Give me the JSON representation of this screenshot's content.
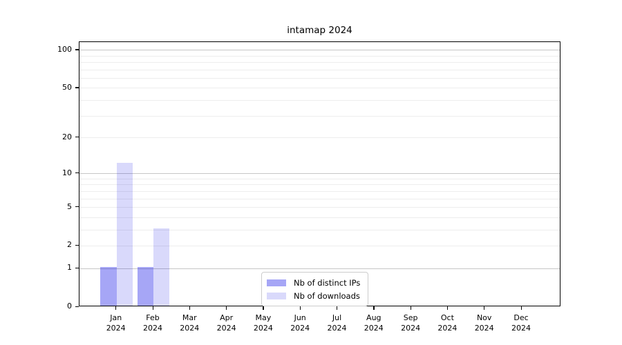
{
  "title": "intamap 2024",
  "chart_data": {
    "type": "bar",
    "title": "intamap 2024",
    "categories": [
      "Jan",
      "Feb",
      "Mar",
      "Apr",
      "May",
      "Jun",
      "Jul",
      "Aug",
      "Sep",
      "Oct",
      "Nov",
      "Dec"
    ],
    "category_year": "2024",
    "series": [
      {
        "name": "Nb of distinct IPs",
        "color": "rgba(0,0,230,0.35)",
        "values": [
          1,
          1,
          0,
          0,
          0,
          0,
          0,
          0,
          0,
          0,
          0,
          0
        ]
      },
      {
        "name": "Nb of downloads",
        "color": "rgba(0,0,230,0.15)",
        "values": [
          12,
          3,
          0,
          0,
          0,
          0,
          0,
          0,
          0,
          0,
          0,
          0
        ]
      }
    ],
    "xlabel": "",
    "ylabel": "",
    "y_axis": {
      "scale": "log1p",
      "ylim": [
        0,
        116
      ],
      "ticks": [
        0,
        1,
        2,
        5,
        10,
        20,
        50,
        100
      ],
      "minor_gridlines": [
        2,
        3,
        4,
        5,
        6,
        7,
        8,
        9,
        20,
        30,
        40,
        50,
        60,
        70,
        80,
        90
      ],
      "major_gridlines": [
        1,
        10,
        100
      ]
    },
    "grid": true,
    "legend": {
      "position": "bottom-center",
      "entries": [
        "Nb of distinct IPs",
        "Nb of downloads"
      ]
    },
    "colors": {
      "bar_distinct_ips": "#a6a6f6",
      "bar_downloads": "#d9d9fb",
      "grid_minor": "#ededed",
      "grid_major": "#c6c6c6",
      "spine": "#000000",
      "background": "#ffffff"
    }
  }
}
